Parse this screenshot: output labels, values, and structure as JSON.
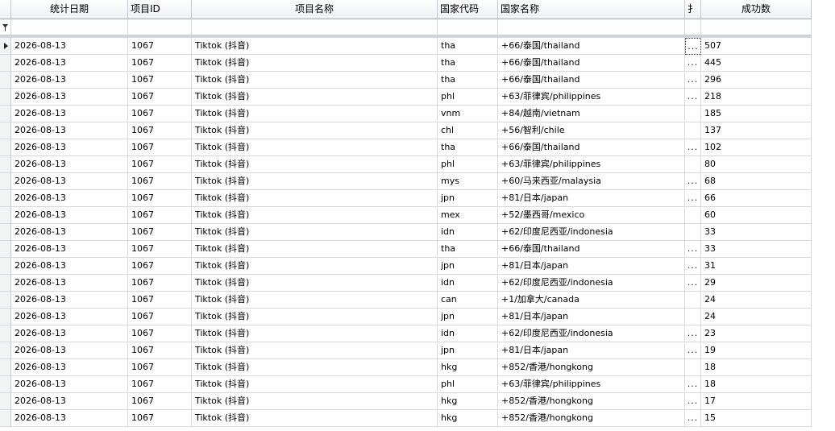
{
  "columns": [
    {
      "key": "date",
      "label": "统计日期"
    },
    {
      "key": "project_id",
      "label": "项目ID"
    },
    {
      "key": "project_name",
      "label": "项目名称"
    },
    {
      "key": "country_code",
      "label": "国家代码"
    },
    {
      "key": "country_name",
      "label": "国家名称"
    },
    {
      "key": "extra",
      "label": "扌"
    },
    {
      "key": "success",
      "label": "成功数"
    }
  ],
  "rows": [
    {
      "date": "2026-08-13",
      "project_id": "1067",
      "project_name": "Tiktok (抖音)",
      "country_code": "tha",
      "country_name": "+66/泰国/thailand",
      "extra": "...",
      "success": "507"
    },
    {
      "date": "2026-08-13",
      "project_id": "1067",
      "project_name": "Tiktok (抖音)",
      "country_code": "tha",
      "country_name": "+66/泰国/thailand",
      "extra": "...",
      "success": "445"
    },
    {
      "date": "2026-08-13",
      "project_id": "1067",
      "project_name": "Tiktok (抖音)",
      "country_code": "tha",
      "country_name": "+66/泰国/thailand",
      "extra": "...",
      "success": "296"
    },
    {
      "date": "2026-08-13",
      "project_id": "1067",
      "project_name": "Tiktok (抖音)",
      "country_code": "phl",
      "country_name": "+63/菲律宾/philippines",
      "extra": "...",
      "success": "218"
    },
    {
      "date": "2026-08-13",
      "project_id": "1067",
      "project_name": "Tiktok (抖音)",
      "country_code": "vnm",
      "country_name": "+84/越南/vietnam",
      "extra": "",
      "success": "185"
    },
    {
      "date": "2026-08-13",
      "project_id": "1067",
      "project_name": "Tiktok (抖音)",
      "country_code": "chl",
      "country_name": "+56/智利/chile",
      "extra": "",
      "success": "137"
    },
    {
      "date": "2026-08-13",
      "project_id": "1067",
      "project_name": "Tiktok (抖音)",
      "country_code": "tha",
      "country_name": "+66/泰国/thailand",
      "extra": "...",
      "success": "102"
    },
    {
      "date": "2026-08-13",
      "project_id": "1067",
      "project_name": "Tiktok (抖音)",
      "country_code": "phl",
      "country_name": "+63/菲律宾/philippines",
      "extra": "",
      "success": "80"
    },
    {
      "date": "2026-08-13",
      "project_id": "1067",
      "project_name": "Tiktok (抖音)",
      "country_code": "mys",
      "country_name": "+60/马来西亚/malaysia",
      "extra": "...",
      "success": "68"
    },
    {
      "date": "2026-08-13",
      "project_id": "1067",
      "project_name": "Tiktok (抖音)",
      "country_code": "jpn",
      "country_name": "+81/日本/japan",
      "extra": "...",
      "success": "66"
    },
    {
      "date": "2026-08-13",
      "project_id": "1067",
      "project_name": "Tiktok (抖音)",
      "country_code": "mex",
      "country_name": "+52/墨西哥/mexico",
      "extra": "",
      "success": "60"
    },
    {
      "date": "2026-08-13",
      "project_id": "1067",
      "project_name": "Tiktok (抖音)",
      "country_code": "idn",
      "country_name": "+62/印度尼西亚/indonesia",
      "extra": "",
      "success": "33"
    },
    {
      "date": "2026-08-13",
      "project_id": "1067",
      "project_name": "Tiktok (抖音)",
      "country_code": "tha",
      "country_name": "+66/泰国/thailand",
      "extra": "...",
      "success": "33"
    },
    {
      "date": "2026-08-13",
      "project_id": "1067",
      "project_name": "Tiktok (抖音)",
      "country_code": "jpn",
      "country_name": "+81/日本/japan",
      "extra": "...",
      "success": "31"
    },
    {
      "date": "2026-08-13",
      "project_id": "1067",
      "project_name": "Tiktok (抖音)",
      "country_code": "idn",
      "country_name": "+62/印度尼西亚/indonesia",
      "extra": "...",
      "success": "29"
    },
    {
      "date": "2026-08-13",
      "project_id": "1067",
      "project_name": "Tiktok (抖音)",
      "country_code": "can",
      "country_name": "+1/加拿大/canada",
      "extra": "",
      "success": "24"
    },
    {
      "date": "2026-08-13",
      "project_id": "1067",
      "project_name": "Tiktok (抖音)",
      "country_code": "jpn",
      "country_name": "+81/日本/japan",
      "extra": "",
      "success": "24"
    },
    {
      "date": "2026-08-13",
      "project_id": "1067",
      "project_name": "Tiktok (抖音)",
      "country_code": "idn",
      "country_name": "+62/印度尼西亚/indonesia",
      "extra": "...",
      "success": "23"
    },
    {
      "date": "2026-08-13",
      "project_id": "1067",
      "project_name": "Tiktok (抖音)",
      "country_code": "jpn",
      "country_name": "+81/日本/japan",
      "extra": "...",
      "success": "19"
    },
    {
      "date": "2026-08-13",
      "project_id": "1067",
      "project_name": "Tiktok (抖音)",
      "country_code": "hkg",
      "country_name": "+852/香港/hongkong",
      "extra": "",
      "success": "18"
    },
    {
      "date": "2026-08-13",
      "project_id": "1067",
      "project_name": "Tiktok (抖音)",
      "country_code": "phl",
      "country_name": "+63/菲律宾/philippines",
      "extra": "...",
      "success": "18"
    },
    {
      "date": "2026-08-13",
      "project_id": "1067",
      "project_name": "Tiktok (抖音)",
      "country_code": "hkg",
      "country_name": "+852/香港/hongkong",
      "extra": "...",
      "success": "17"
    },
    {
      "date": "2026-08-13",
      "project_id": "1067",
      "project_name": "Tiktok (抖音)",
      "country_code": "hkg",
      "country_name": "+852/香港/hongkong",
      "extra": "...",
      "success": "15"
    }
  ],
  "current_row_index": 0
}
